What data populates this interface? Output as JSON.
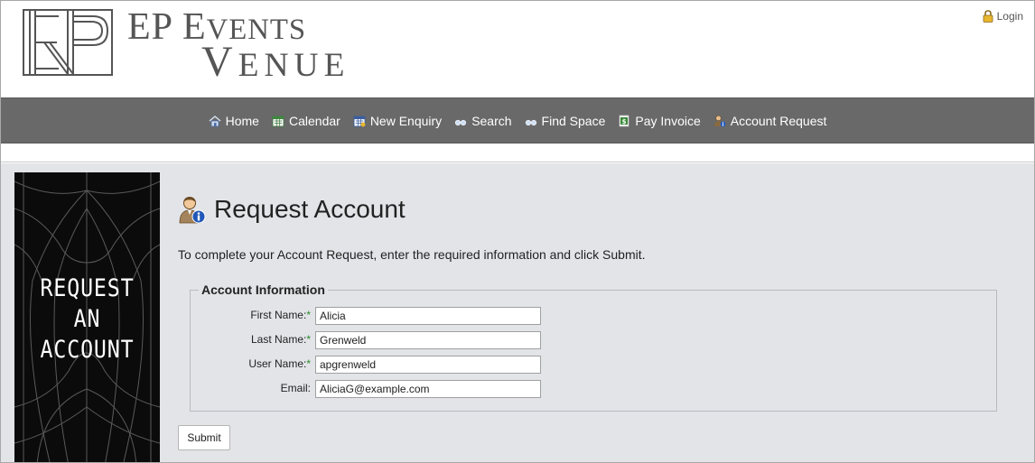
{
  "brand": {
    "line1_initial": "EP E",
    "line1_rest": "VENTS",
    "line2_initial": "V",
    "line2_rest": "ENUE"
  },
  "header": {
    "login_label": "Login"
  },
  "nav": {
    "items": [
      {
        "label": "Home",
        "icon": "home-icon"
      },
      {
        "label": "Calendar",
        "icon": "calendar-icon"
      },
      {
        "label": "New Enquiry",
        "icon": "new-enquiry-icon"
      },
      {
        "label": "Search",
        "icon": "binoculars-icon"
      },
      {
        "label": "Find Space",
        "icon": "binoculars-icon"
      },
      {
        "label": "Pay Invoice",
        "icon": "dollar-icon"
      },
      {
        "label": "Account Request",
        "icon": "user-info-icon"
      }
    ]
  },
  "banner": {
    "line1": "REQUEST",
    "line2": "AN",
    "line3": "ACCOUNT"
  },
  "page": {
    "title": "Request Account",
    "intro": "To complete your Account Request, enter the required information and click Submit."
  },
  "form": {
    "legend": "Account Information",
    "fields": [
      {
        "label": "First Name:",
        "required": "*",
        "value": "Alicia"
      },
      {
        "label": "Last Name:",
        "required": "*",
        "value": "Grenweld"
      },
      {
        "label": "User Name:",
        "required": "*",
        "value": "apgrenweld"
      },
      {
        "label": "Email:",
        "required": "",
        "value": "AliciaG@example.com"
      }
    ],
    "submit_label": "Submit"
  },
  "colors": {
    "navbar": "#696969",
    "content_bg": "#e2e4e8",
    "required_mark": "#2a8a2a",
    "logo": "#555555"
  }
}
